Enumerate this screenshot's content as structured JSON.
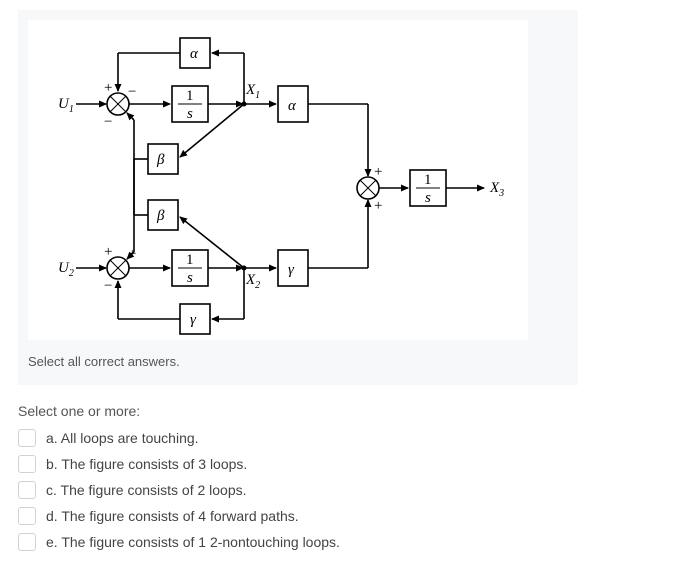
{
  "diagram": {
    "inputs": {
      "u1": "U",
      "u1_sub": "1",
      "u2": "U",
      "u2_sub": "2"
    },
    "signals": {
      "x1": "X",
      "x1_sub": "1",
      "x2": "X",
      "x2_sub": "2",
      "x3": "X",
      "x3_sub": "3"
    },
    "blocks": {
      "alpha_top": "α",
      "alpha_right": "α",
      "integrator1_num": "1",
      "integrator1_den": "s",
      "integrator2_num": "1",
      "integrator2_den": "s",
      "integrator3_num": "1",
      "integrator3_den": "s",
      "beta_top": "β",
      "beta_bottom": "β",
      "gamma_right": "γ",
      "gamma_bottom": "γ"
    },
    "signs": {
      "plus": "+",
      "minus": "−"
    }
  },
  "instruction": "Select all correct answers.",
  "prompt": "Select one or more:",
  "options": [
    {
      "label": "a. All loops are touching."
    },
    {
      "label": "b. The figure consists of 3 loops."
    },
    {
      "label": "c. The figure consists of 2 loops."
    },
    {
      "label": "d. The figure consists of 4 forward paths."
    },
    {
      "label": "e. The figure consists of 1 2-nontouching loops."
    }
  ]
}
